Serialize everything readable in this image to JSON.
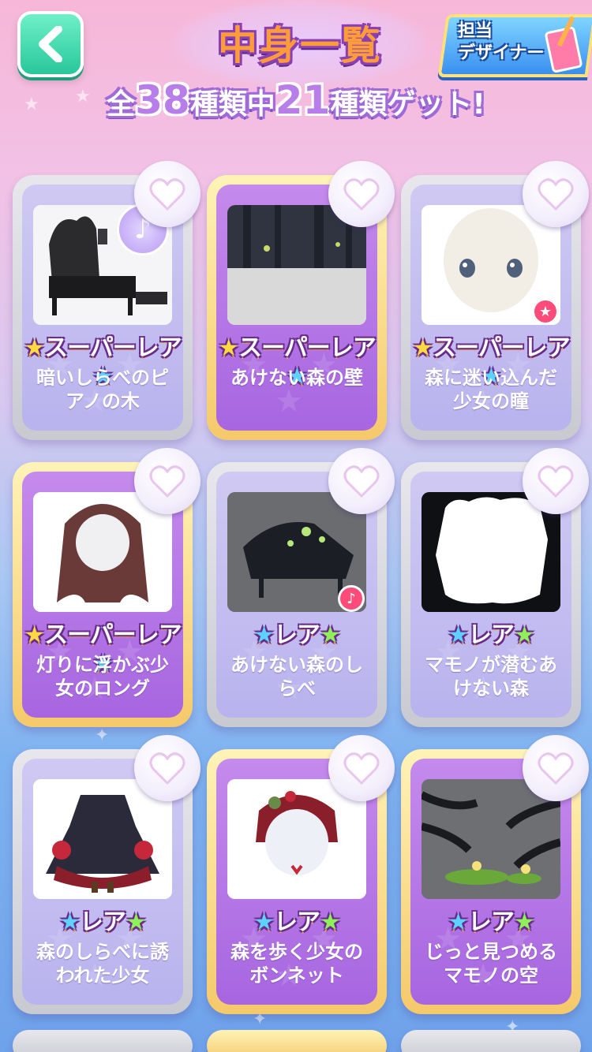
{
  "header": {
    "title": "中身一覧",
    "back_icon": "chevron-left-icon",
    "designer_label": "担当\nデザイナー",
    "designer_line1": "担当",
    "designer_line2": "デザイナー"
  },
  "progress": {
    "prefix": "全",
    "total": "38",
    "middle": "種類中",
    "owned": "21",
    "suffix": "種類ゲット!"
  },
  "colors": {
    "back_button": "#28c79a",
    "title_fill": "#ff9c3a",
    "title_outline": "#8a3fb4",
    "card_gold": "#f5c96a",
    "card_silver": "#c9c9d2",
    "badge_pink": "#ff4b79"
  },
  "items": [
    {
      "rarity": "スーパーレア",
      "name": "暗いしらべのピアノの木",
      "frame": "silver",
      "icon": "piano-tree-icon",
      "extra": "music-note-badge"
    },
    {
      "rarity": "スーパーレア",
      "name": "あけない森の壁",
      "frame": "gold",
      "icon": "forest-wall-icon"
    },
    {
      "rarity": "スーパーレア",
      "name": "森に迷い込んだ少女の瞳",
      "frame": "silver",
      "icon": "eyes-icon",
      "extra": "star-badge"
    },
    {
      "rarity": "スーパーレア",
      "name": "灯りに浮かぶ少女のロング",
      "frame": "gold",
      "icon": "long-hair-icon"
    },
    {
      "rarity": "レア",
      "name": "あけない森のしらべ",
      "frame": "silver",
      "icon": "forest-piano-icon",
      "extra": "music-badge"
    },
    {
      "rarity": "レア",
      "name": "マモノが潜むあけない森",
      "frame": "silver",
      "icon": "dark-forest-frame-icon"
    },
    {
      "rarity": "レア",
      "name": "森のしらべに誘われた少女",
      "frame": "silver",
      "icon": "dress-icon"
    },
    {
      "rarity": "レア",
      "name": "森を歩く少女のボンネット",
      "frame": "gold",
      "icon": "bonnet-icon"
    },
    {
      "rarity": "レア",
      "name": "じっと見つめるマモノの空",
      "frame": "gold",
      "icon": "monster-sky-icon"
    }
  ],
  "name_lines": [
    [
      "暗いしらべのピ",
      "アノの木"
    ],
    [
      "あけない森の壁"
    ],
    [
      "森に迷い込んだ",
      "少女の瞳"
    ],
    [
      "灯りに浮かぶ少",
      "女のロング"
    ],
    [
      "あけない森のし",
      "らべ"
    ],
    [
      "マモノが潜むあ",
      "けない森"
    ],
    [
      "森のしらべに誘",
      "われた少女"
    ],
    [
      "森を歩く少女の",
      "ボンネット"
    ],
    [
      "じっと見つめる",
      "マモノの空"
    ]
  ],
  "heart_icon": "heart-icon"
}
